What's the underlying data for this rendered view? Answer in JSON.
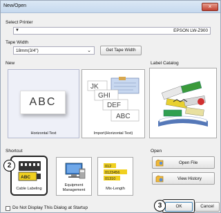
{
  "window": {
    "title": "New/Open",
    "close_glyph": "×"
  },
  "printer": {
    "label": "Select Printer",
    "value": "EPSON LW-Z900",
    "arrow": "▼"
  },
  "tape": {
    "label": "Tape Width",
    "value": "18mm(3/4\")",
    "arrow": "⌄",
    "button": "Get Tape Width"
  },
  "new": {
    "label": "New",
    "items": [
      {
        "label": "Horizontal Text",
        "preview": "ABC"
      },
      {
        "label": "Import(Horizontal Text)",
        "preview_lines": [
          "JK",
          "GHI",
          "DEF",
          "ABC"
        ]
      }
    ]
  },
  "catalog": {
    "label": "Label Catalog"
  },
  "shortcut": {
    "label": "Shortcut",
    "items": [
      {
        "label": "Cable Labeling",
        "mini": "ABC"
      },
      {
        "label": "Equipment Management"
      },
      {
        "label": "Mix-Length",
        "numbers": [
          "012",
          "0123456",
          "01310"
        ]
      }
    ]
  },
  "open": {
    "label": "Open",
    "open_file": "Open File",
    "view_history": "View History"
  },
  "footer": {
    "checkbox_label": "Do Not Display This Dialog at Startup",
    "ok": "OK",
    "cancel": "Cancel"
  },
  "callouts": {
    "two": "2",
    "three": "3"
  }
}
